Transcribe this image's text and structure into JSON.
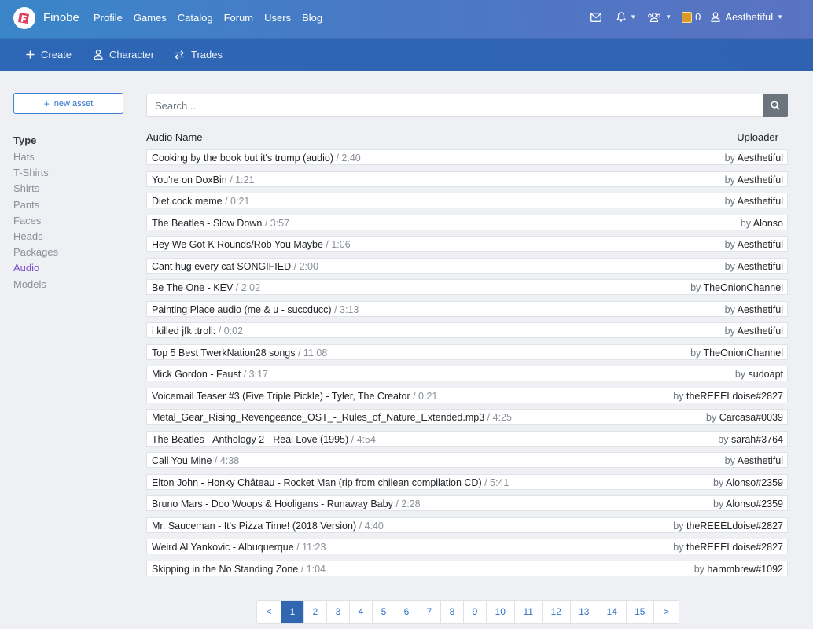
{
  "nav": {
    "brand": "Finobe",
    "links": [
      "Profile",
      "Games",
      "Catalog",
      "Forum",
      "Users",
      "Blog"
    ],
    "coins": "0",
    "username": "Aesthetiful"
  },
  "subnav": {
    "create": "Create",
    "character": "Character",
    "trades": "Trades"
  },
  "sidebar": {
    "new_asset": "new asset",
    "type_heading": "Type",
    "types": [
      "Hats",
      "T-Shirts",
      "Shirts",
      "Pants",
      "Faces",
      "Heads",
      "Packages",
      "Audio",
      "Models"
    ],
    "active_type": "Audio"
  },
  "search": {
    "placeholder": "Search..."
  },
  "table": {
    "col_name": "Audio Name",
    "col_uploader": "Uploader",
    "by_prefix": "by ",
    "rows": [
      {
        "name": "Cooking by the book but it's trump (audio)",
        "duration": " / 2:40",
        "uploader": "Aesthetiful"
      },
      {
        "name": "You're on DoxBin",
        "duration": " / 1:21",
        "uploader": "Aesthetiful"
      },
      {
        "name": "Diet cock meme",
        "duration": " / 0:21",
        "uploader": "Aesthetiful"
      },
      {
        "name": "The Beatles - Slow Down",
        "duration": " / 3:57",
        "uploader": "Alonso"
      },
      {
        "name": "Hey We Got K Rounds/Rob You Maybe",
        "duration": " / 1:06",
        "uploader": "Aesthetiful"
      },
      {
        "name": "Cant hug every cat SONGIFIED",
        "duration": " / 2:00",
        "uploader": "Aesthetiful"
      },
      {
        "name": "Be The One - KEV",
        "duration": " / 2:02",
        "uploader": "TheOnionChannel"
      },
      {
        "name": "Painting Place audio (me & u - succducc)",
        "duration": " / 3:13",
        "uploader": "Aesthetiful"
      },
      {
        "name": "i killed jfk :troll:",
        "duration": " / 0:02",
        "uploader": "Aesthetiful"
      },
      {
        "name": "Top 5 Best TwerkNation28 songs",
        "duration": " / 11:08",
        "uploader": "TheOnionChannel"
      },
      {
        "name": "Mick Gordon - Faust",
        "duration": " / 3:17",
        "uploader": "sudoapt"
      },
      {
        "name": "Voicemail Teaser #3 (Five Triple Pickle) - Tyler, The Creator",
        "duration": " / 0:21",
        "uploader": "theREEELdoise#2827"
      },
      {
        "name": "Metal_Gear_Rising_Revengeance_OST_-_Rules_of_Nature_Extended.mp3",
        "duration": " / 4:25",
        "uploader": "Carcasa#0039"
      },
      {
        "name": "The Beatles - Anthology 2 - Real Love (1995)",
        "duration": " / 4:54",
        "uploader": "sarah#3764"
      },
      {
        "name": "Call You Mine",
        "duration": " / 4:38",
        "uploader": "Aesthetiful"
      },
      {
        "name": "Elton John - Honky Château - Rocket Man (rip from chilean compilation CD)",
        "duration": " / 5:41",
        "uploader": "Alonso#2359"
      },
      {
        "name": "Bruno Mars - Doo Woops & Hooligans - Runaway Baby",
        "duration": " / 2:28",
        "uploader": "Alonso#2359"
      },
      {
        "name": "Mr. Sauceman - It's Pizza Time! (2018 Version)",
        "duration": " / 4:40",
        "uploader": "theREEELdoise#2827"
      },
      {
        "name": "Weird Al Yankovic - Albuquerque",
        "duration": " / 11:23",
        "uploader": "theREEELdoise#2827"
      },
      {
        "name": "Skipping in the No Standing Zone",
        "duration": " / 1:04",
        "uploader": "hammbrew#1092"
      }
    ]
  },
  "pagination": {
    "prev": "<",
    "next": ">",
    "pages": [
      "1",
      "2",
      "3",
      "4",
      "5",
      "6",
      "7",
      "8",
      "9",
      "10",
      "11",
      "12",
      "13",
      "14",
      "15"
    ],
    "current": "1"
  },
  "colors": {
    "accent": "#2f67b1",
    "active_type": "#7b4fd1"
  }
}
